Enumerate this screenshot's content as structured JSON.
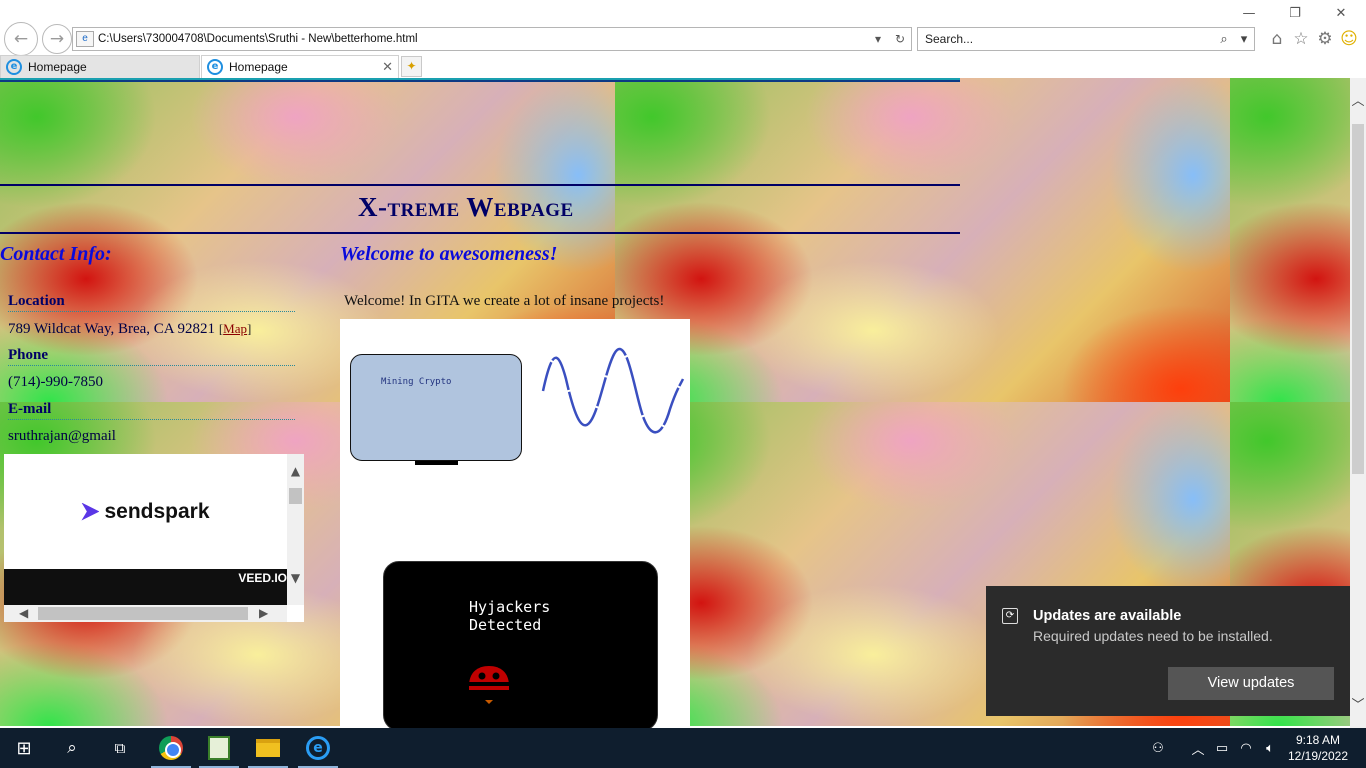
{
  "browser": {
    "address": "C:\\Users\\730004708\\Documents\\Sruthi - New\\betterhome.html",
    "search_placeholder": "Search...",
    "tabs": [
      {
        "label": "Homepage"
      },
      {
        "label": "Homepage"
      }
    ]
  },
  "page": {
    "site_title": "X-treme Webpage",
    "contact_heading": "Contact Info:",
    "welcome_heading": "Welcome to awesomeness!",
    "welcome_text": "Welcome! In GITA we create a lot of insane projects!",
    "contact": {
      "location_label": "Location",
      "location_value": "789 Wildcat Way, Brea, CA 92821",
      "map_link": "Map",
      "phone_label": "Phone",
      "phone_value": "(714)-990-7850",
      "email_label": "E-mail",
      "email_value": "sruthrajan@gmail"
    },
    "video": {
      "logo_text": "sendspark",
      "watermark": "VEED.IO"
    },
    "projects": {
      "mining_label": "Mining Crypto",
      "hyjackers_line1": "Hyjackers",
      "hyjackers_line2": "Detected"
    }
  },
  "notification": {
    "title": "Updates are available",
    "subtitle": "Required updates need to be installed.",
    "button": "View updates"
  },
  "taskbar": {
    "time": "9:18 AM",
    "date": "12/19/2022"
  },
  "colors": {
    "heading_blue": "#0a0adb",
    "title_navy": "#000066",
    "mining_screen": "#b0c4de",
    "toast_bg": "#2b2b2b",
    "taskbar_bg": "#0f1e2e"
  }
}
